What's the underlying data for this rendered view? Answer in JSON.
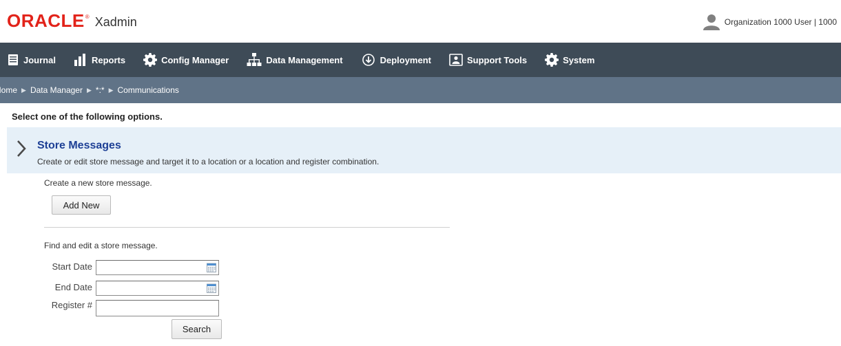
{
  "header": {
    "logo_text": "ORACLE",
    "logo_mark": "®",
    "app_name": "Xadmin",
    "user_text": "Organization 1000 User | 1000",
    "user_icon": "user-avatar-icon",
    "brand_color": "#e2231a"
  },
  "nav": {
    "items": [
      {
        "label": "Journal",
        "icon": "journal-icon"
      },
      {
        "label": "Reports",
        "icon": "bar-chart-icon"
      },
      {
        "label": "Config Manager",
        "icon": "gear-icon"
      },
      {
        "label": "Data Management",
        "icon": "hierarchy-icon"
      },
      {
        "label": "Deployment",
        "icon": "cloud-download-icon"
      },
      {
        "label": "Support Tools",
        "icon": "support-tools-icon"
      },
      {
        "label": "System",
        "icon": "gear-icon"
      }
    ],
    "background": "#3e4b57"
  },
  "breadcrumb": {
    "items": [
      "Home",
      "Data Manager",
      "*:*",
      "Communications"
    ],
    "separator": "▶",
    "background": "#607387"
  },
  "main": {
    "instruction": "Select one of the following options.",
    "section": {
      "title": "Store Messages",
      "description": "Create or edit store message and target it to a location or a location and register combination.",
      "background": "#e6f0f8",
      "title_color": "#1d3f95"
    },
    "create": {
      "label": "Create a new store message.",
      "button_label": "Add New"
    },
    "find": {
      "label": "Find and edit a store message.",
      "start_date_label": "Start Date",
      "start_date_value": "",
      "end_date_label": "End Date",
      "end_date_value": "",
      "register_label": "Register #",
      "register_value": "",
      "search_button_label": "Search"
    }
  }
}
